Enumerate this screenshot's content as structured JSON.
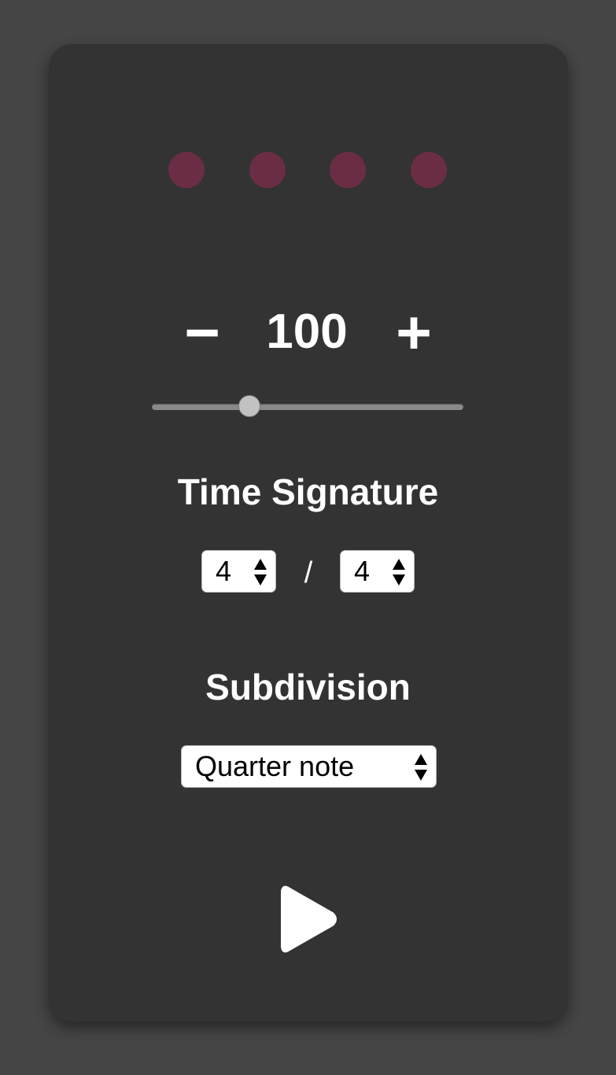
{
  "metronome": {
    "beat_count": 4,
    "bpm": "100",
    "tempo_min": 40,
    "tempo_max": 240,
    "decrement_label": "−",
    "increment_label": "+",
    "time_signature": {
      "title": "Time Signature",
      "beats_per_measure": "4",
      "separator": "/",
      "note_value": "4"
    },
    "subdivision": {
      "title": "Subdivision",
      "selected": "Quarter note"
    },
    "play_icon": "play-icon",
    "colors": {
      "beat_inactive": "#6b2d45",
      "background": "#454545",
      "card": "#333333",
      "text": "#ffffff"
    }
  }
}
